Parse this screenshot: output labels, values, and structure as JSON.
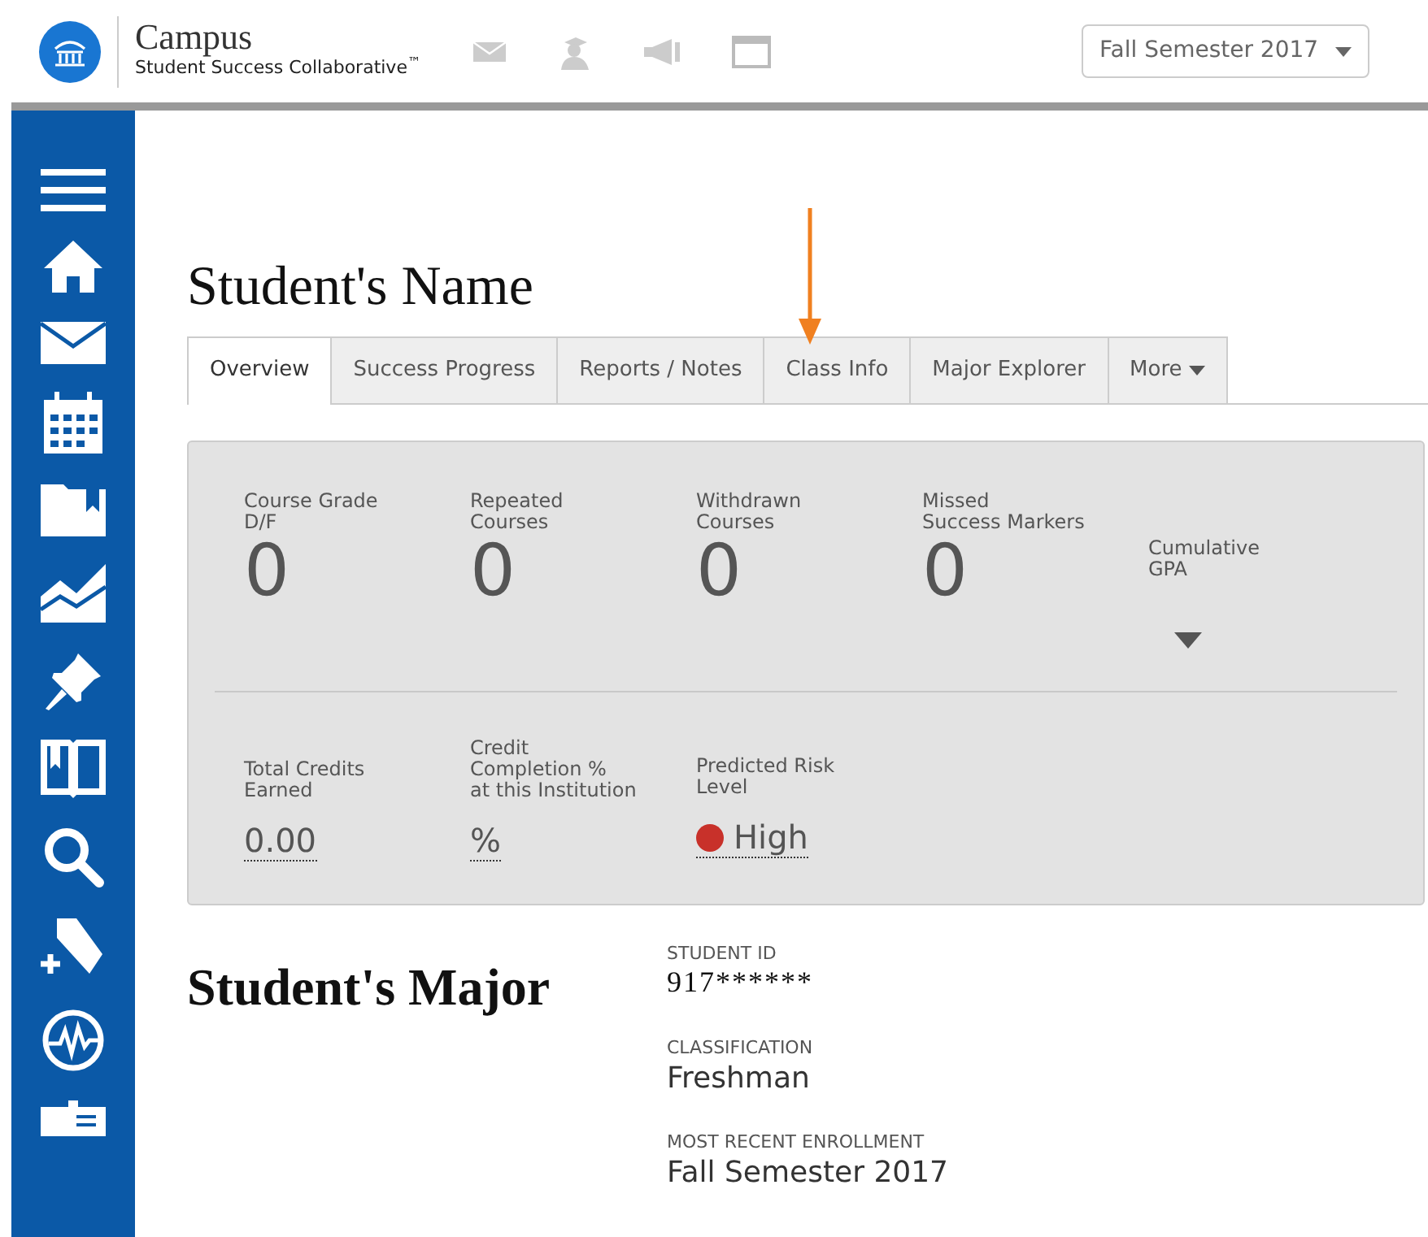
{
  "header": {
    "title": "Campus",
    "subtitle": "Student Success Collaborative$^{™}$",
    "term_select": "Fall Semester 2017"
  },
  "student_name": "Student's Name",
  "tabs": [
    {
      "label": "Overview",
      "selected": true,
      "kind": "link"
    },
    {
      "label": "Success Progress",
      "selected": false,
      "kind": "link"
    },
    {
      "label": "Reports / Notes",
      "selected": false,
      "kind": "link"
    },
    {
      "label": "Class Info",
      "selected": false,
      "kind": "link"
    },
    {
      "label": "Major Explorer",
      "selected": false,
      "kind": "link"
    },
    {
      "label": "More",
      "selected": false,
      "kind": "menu"
    }
  ],
  "metrics": [
    {
      "label": "Course Grade\nD/F",
      "value": "0",
      "kind": "number"
    },
    {
      "label": "Repeated\nCourses",
      "value": "0",
      "kind": "number"
    },
    {
      "label": "Withdrawn\nCourses",
      "value": "0",
      "kind": "number"
    },
    {
      "label": "Missed\nSuccess Markers",
      "value": "0",
      "kind": "number"
    },
    {
      "label": "Cumulative\nGPA",
      "kind": "toggle"
    }
  ],
  "summary": [
    {
      "label": "Total Credits\nEarned",
      "value": "0.00"
    },
    {
      "label": "Credit\nCompletion %\nat this Institution",
      "value": "%"
    },
    {
      "label": "Predicted Risk\nLevel",
      "value": "High",
      "color": "#c8312a"
    }
  ],
  "major": "Student's Major",
  "details": [
    {
      "label": "STUDENT ID",
      "value": "917******",
      "kind": "serif"
    },
    {
      "label": "CLASSIFICATION",
      "value": "Freshman",
      "kind": "sans"
    },
    {
      "label": "MOST RECENT ENROLLMENT",
      "value": "Fall Semester 2017",
      "kind": "sans"
    }
  ]
}
